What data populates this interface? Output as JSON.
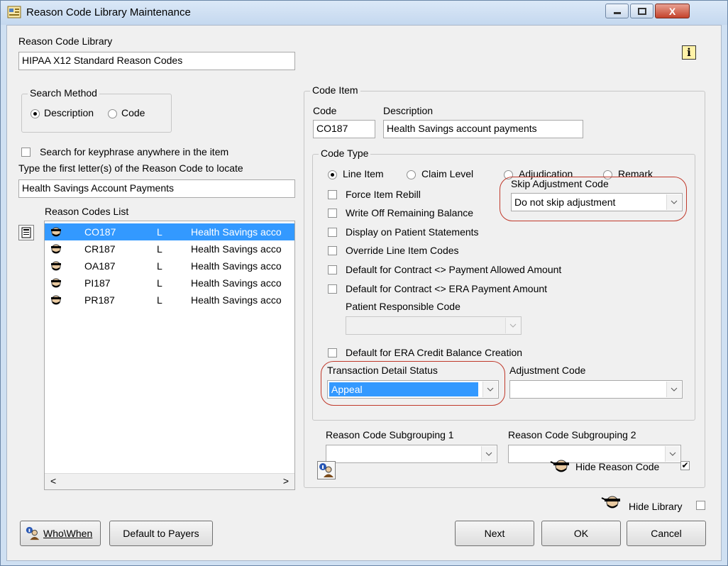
{
  "window": {
    "title": "Reason Code Library Maintenance",
    "close_glyph": "X"
  },
  "library": {
    "label": "Reason Code Library",
    "value": "HIPAA X12 Standard Reason Codes"
  },
  "search_method": {
    "legend": "Search Method",
    "description_label": "Description",
    "code_label": "Code",
    "selected": "Description"
  },
  "keyphrase": {
    "label": "Search for keyphrase anywhere in the item",
    "checked": false
  },
  "locate": {
    "label": "Type the first letter(s) of the Reason Code to locate",
    "value": "Health Savings Account Payments"
  },
  "reason_list": {
    "label": "Reason Codes List",
    "rows": [
      {
        "code": "CO187",
        "type": "L",
        "desc": "Health Savings acco",
        "selected": true
      },
      {
        "code": "CR187",
        "type": "L",
        "desc": "Health Savings acco",
        "selected": false
      },
      {
        "code": "OA187",
        "type": "L",
        "desc": "Health Savings acco",
        "selected": false
      },
      {
        "code": "PI187",
        "type": "L",
        "desc": "Health Savings acco",
        "selected": false
      },
      {
        "code": "PR187",
        "type": "L",
        "desc": "Health Savings acco",
        "selected": false
      }
    ],
    "scroll_left": "<",
    "scroll_right": ">"
  },
  "code_item": {
    "legend": "Code Item",
    "code_label": "Code",
    "code_value": "CO187",
    "desc_label": "Description",
    "desc_value": "Health Savings account payments"
  },
  "code_type": {
    "legend": "Code Type",
    "options": [
      "Line Item",
      "Claim Level",
      "Adjudication",
      "Remark"
    ],
    "selected": "Line Item",
    "checks": {
      "force_rebill": "Force Item Rebill",
      "write_off": "Write Off Remaining Balance",
      "display_statements": "Display on Patient Statements",
      "override_line": "Override Line Item Codes",
      "default_allowed": "Default for Contract <> Payment Allowed Amount",
      "default_era": "Default for Contract <> ERA Payment Amount",
      "default_credit": "Default for ERA Credit Balance Creation"
    },
    "skip_adj_label": "Skip Adjustment Code",
    "skip_adj_value": "Do not skip adjustment",
    "patient_resp_label": "Patient Responsible Code",
    "patient_resp_value": "",
    "txn_status_label": "Transaction Detail Status",
    "txn_status_value": "Appeal",
    "adj_code_label": "Adjustment Code",
    "adj_code_value": "",
    "subgroup1_label": "Reason Code Subgrouping 1",
    "subgroup1_value": "",
    "subgroup2_label": "Reason Code Subgrouping 2",
    "subgroup2_value": ""
  },
  "hide_reason": {
    "label": "Hide Reason Code",
    "checked": true,
    "mark": "✔"
  },
  "hide_library": {
    "label": "Hide Library",
    "checked": false
  },
  "buttons": {
    "who_when": "Who\\When",
    "default_payers": "Default to Payers",
    "next": "Next",
    "ok": "OK",
    "cancel": "Cancel"
  },
  "info_icon_glyph": "i",
  "colors": {
    "selection": "#3399ff",
    "highlight_ring": "#c0392b"
  }
}
